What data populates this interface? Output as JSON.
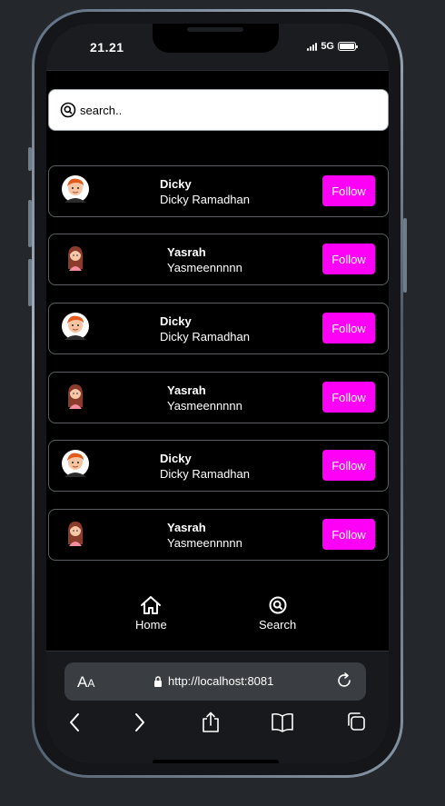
{
  "status_bar": {
    "time": "21.21",
    "network": "5G"
  },
  "search": {
    "placeholder": "search.."
  },
  "users": [
    {
      "name": "Dicky",
      "handle": "Dicky Ramadhan",
      "avatar": "male-avatar-icon",
      "follow_label": "Follow"
    },
    {
      "name": "Yasrah",
      "handle": "Yasmeennnnn",
      "avatar": "female-avatar-icon",
      "follow_label": "Follow"
    },
    {
      "name": "Dicky",
      "handle": "Dicky Ramadhan",
      "avatar": "male-avatar-icon",
      "follow_label": "Follow"
    },
    {
      "name": "Yasrah",
      "handle": "Yasmeennnnn",
      "avatar": "female-avatar-icon",
      "follow_label": "Follow"
    },
    {
      "name": "Dicky",
      "handle": "Dicky Ramadhan",
      "avatar": "male-avatar-icon",
      "follow_label": "Follow"
    },
    {
      "name": "Yasrah",
      "handle": "Yasmeennnnn",
      "avatar": "female-avatar-icon",
      "follow_label": "Follow"
    }
  ],
  "tabs": [
    {
      "label": "Home",
      "icon": "home-icon"
    },
    {
      "label": "Search",
      "icon": "search-icon"
    }
  ],
  "browser": {
    "text_size_label": "AA",
    "url": "http://localhost:8081"
  },
  "colors": {
    "follow_button": "#ff00f6",
    "screen_background": "#000000",
    "page_background": "#24282c"
  }
}
